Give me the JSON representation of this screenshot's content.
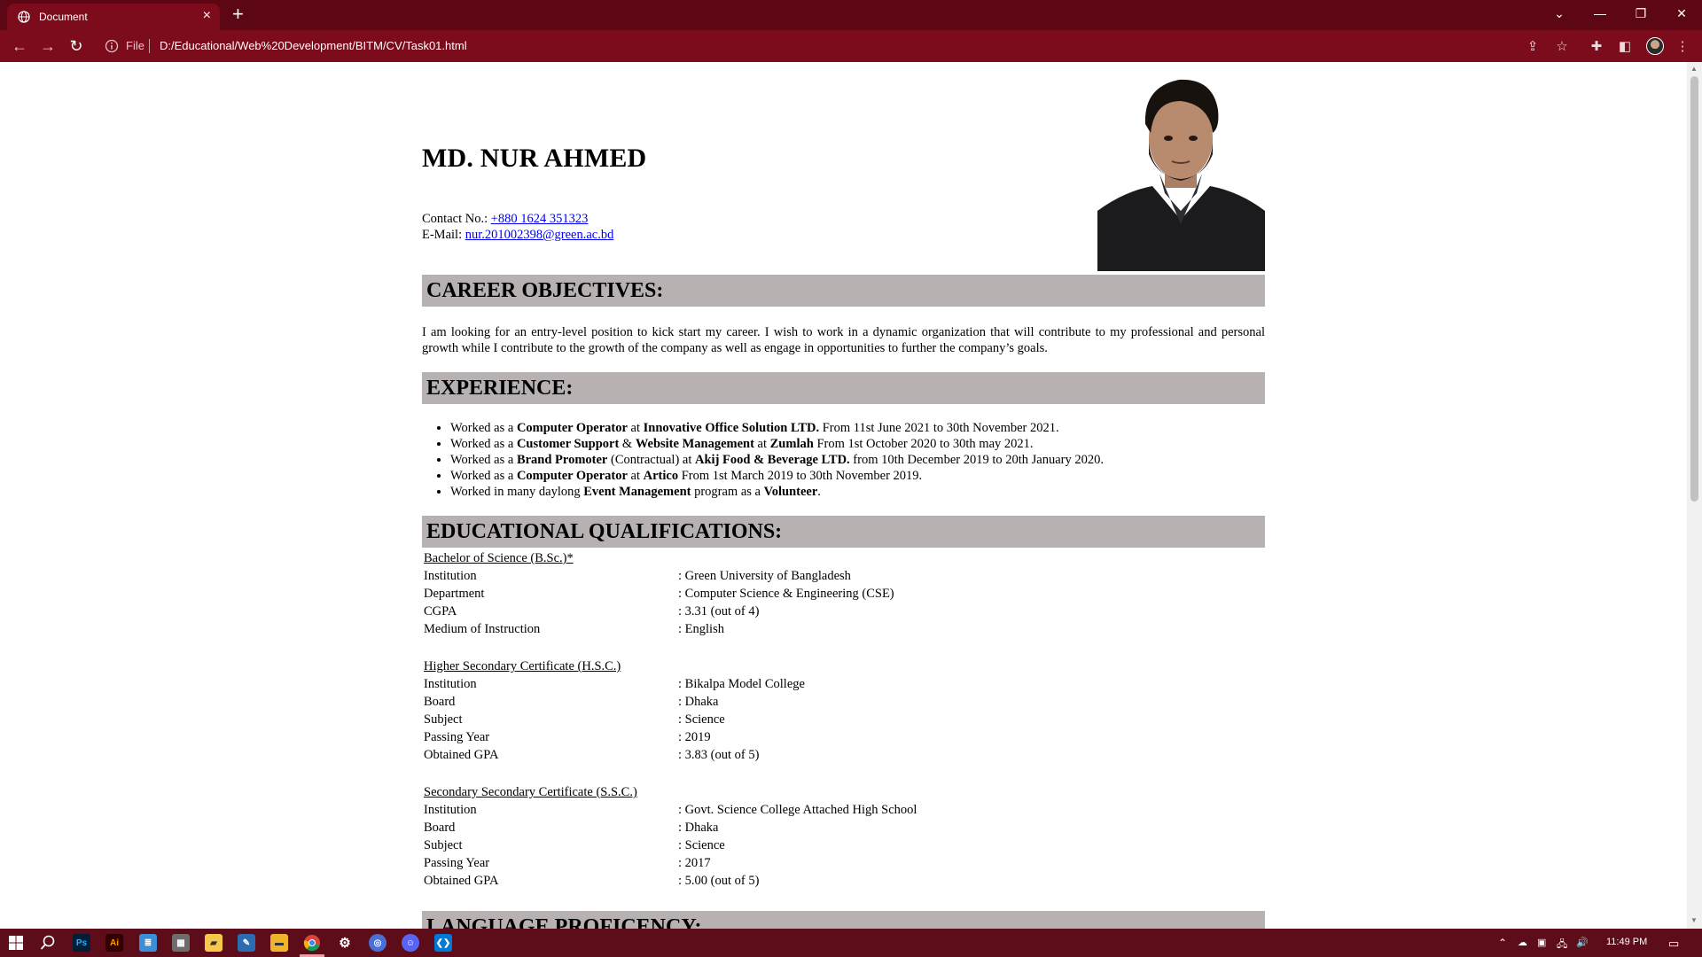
{
  "browser": {
    "tab_title": "Document",
    "tab_close": "×",
    "new_tab": "+",
    "omnibox_scheme": "File",
    "url": "D:/Educational/Web%20Development/BITM/CV/Task01.html"
  },
  "cv": {
    "name": "MD. NUR AHMED",
    "contact_label": "Contact No.: ",
    "contact_value": "+880 1624 351323",
    "email_label": "E-Mail: ",
    "email_value": "nur.201002398@green.ac.bd",
    "career_heading": "CAREER OBJECTIVES:",
    "career_text": "I am looking for an entry-level position to kick start my career. I wish to work in a dynamic organization that will contribute to my professional and personal growth while I contribute to the growth of the company as well as engage in opportunities to further the company’s goals.",
    "experience_heading": "EXPERIENCE:",
    "experience": [
      {
        "a": "Worked as a ",
        "b": "Computer Operator",
        "c": " at ",
        "d": "Innovative Office Solution LTD.",
        "e": " From 11st June 2021 to 30th November 2021."
      },
      {
        "a": "Worked as a ",
        "b": "Customer Support",
        "c": " & ",
        "d": "Website Management",
        "e": " at ",
        "f": "Zumlah",
        "g": " From 1st October 2020 to 30th may 2021."
      },
      {
        "a": "Worked as a ",
        "b": "Brand Promoter",
        "c": " (Contractual) at ",
        "d": "Akij Food & Beverage LTD.",
        "e": " from 10th December 2019 to 20th January 2020."
      },
      {
        "a": "Worked as a ",
        "b": "Computer Operator",
        "c": " at ",
        "d": "Artico",
        "e": " From 1st March 2019 to 30th November 2019."
      },
      {
        "a": "Worked in many daylong ",
        "b": "Event Management",
        "c": " program as a ",
        "d": "Volunteer",
        "e": "."
      }
    ],
    "education_heading": "EDUCATIONAL QUALIFICATIONS:",
    "education": [
      {
        "title": "Bachelor of Science (B.Sc.)*",
        "rows": [
          {
            "k": "Institution",
            "v": ": Green University of Bangladesh"
          },
          {
            "k": "Department",
            "v": ": Computer Science & Engineering (CSE)"
          },
          {
            "k": "CGPA",
            "v": ": 3.31 (out of 4)"
          },
          {
            "k": "Medium of Instruction",
            "v": ": English"
          }
        ]
      },
      {
        "title": "Higher Secondary Certificate (H.S.C.)",
        "rows": [
          {
            "k": "Institution",
            "v": ": Bikalpa Model College"
          },
          {
            "k": "Board",
            "v": ": Dhaka"
          },
          {
            "k": "Subject",
            "v": ": Science"
          },
          {
            "k": "Passing Year",
            "v": ": 2019"
          },
          {
            "k": "Obtained GPA",
            "v": ": 3.83 (out of 5)"
          }
        ]
      },
      {
        "title": "Secondary Secondary Certificate (S.S.C.)",
        "rows": [
          {
            "k": "Institution",
            "v": ": Govt. Science College Attached High School"
          },
          {
            "k": "Board",
            "v": ": Dhaka"
          },
          {
            "k": "Subject",
            "v": ": Science"
          },
          {
            "k": "Passing Year",
            "v": ": 2017"
          },
          {
            "k": "Obtained GPA",
            "v": ": 5.00 (out of 5)"
          }
        ]
      }
    ],
    "language_heading": "LANGUAGE PROFICENCY:"
  },
  "taskbar": {
    "clock": "11:49 PM",
    "apps": [
      "windows-start",
      "search",
      "photoshop",
      "illustrator",
      "notepad",
      "calculator",
      "sticky-notes",
      "paint",
      "file-explorer",
      "chrome",
      "settings",
      "vpn",
      "discord",
      "vscode"
    ]
  },
  "colors": {
    "chrome_frame": "#5d0714",
    "chrome_toolbar": "#7c0b1c",
    "section_heading_bg": "#b7b1b2",
    "link": "#0000ee"
  }
}
